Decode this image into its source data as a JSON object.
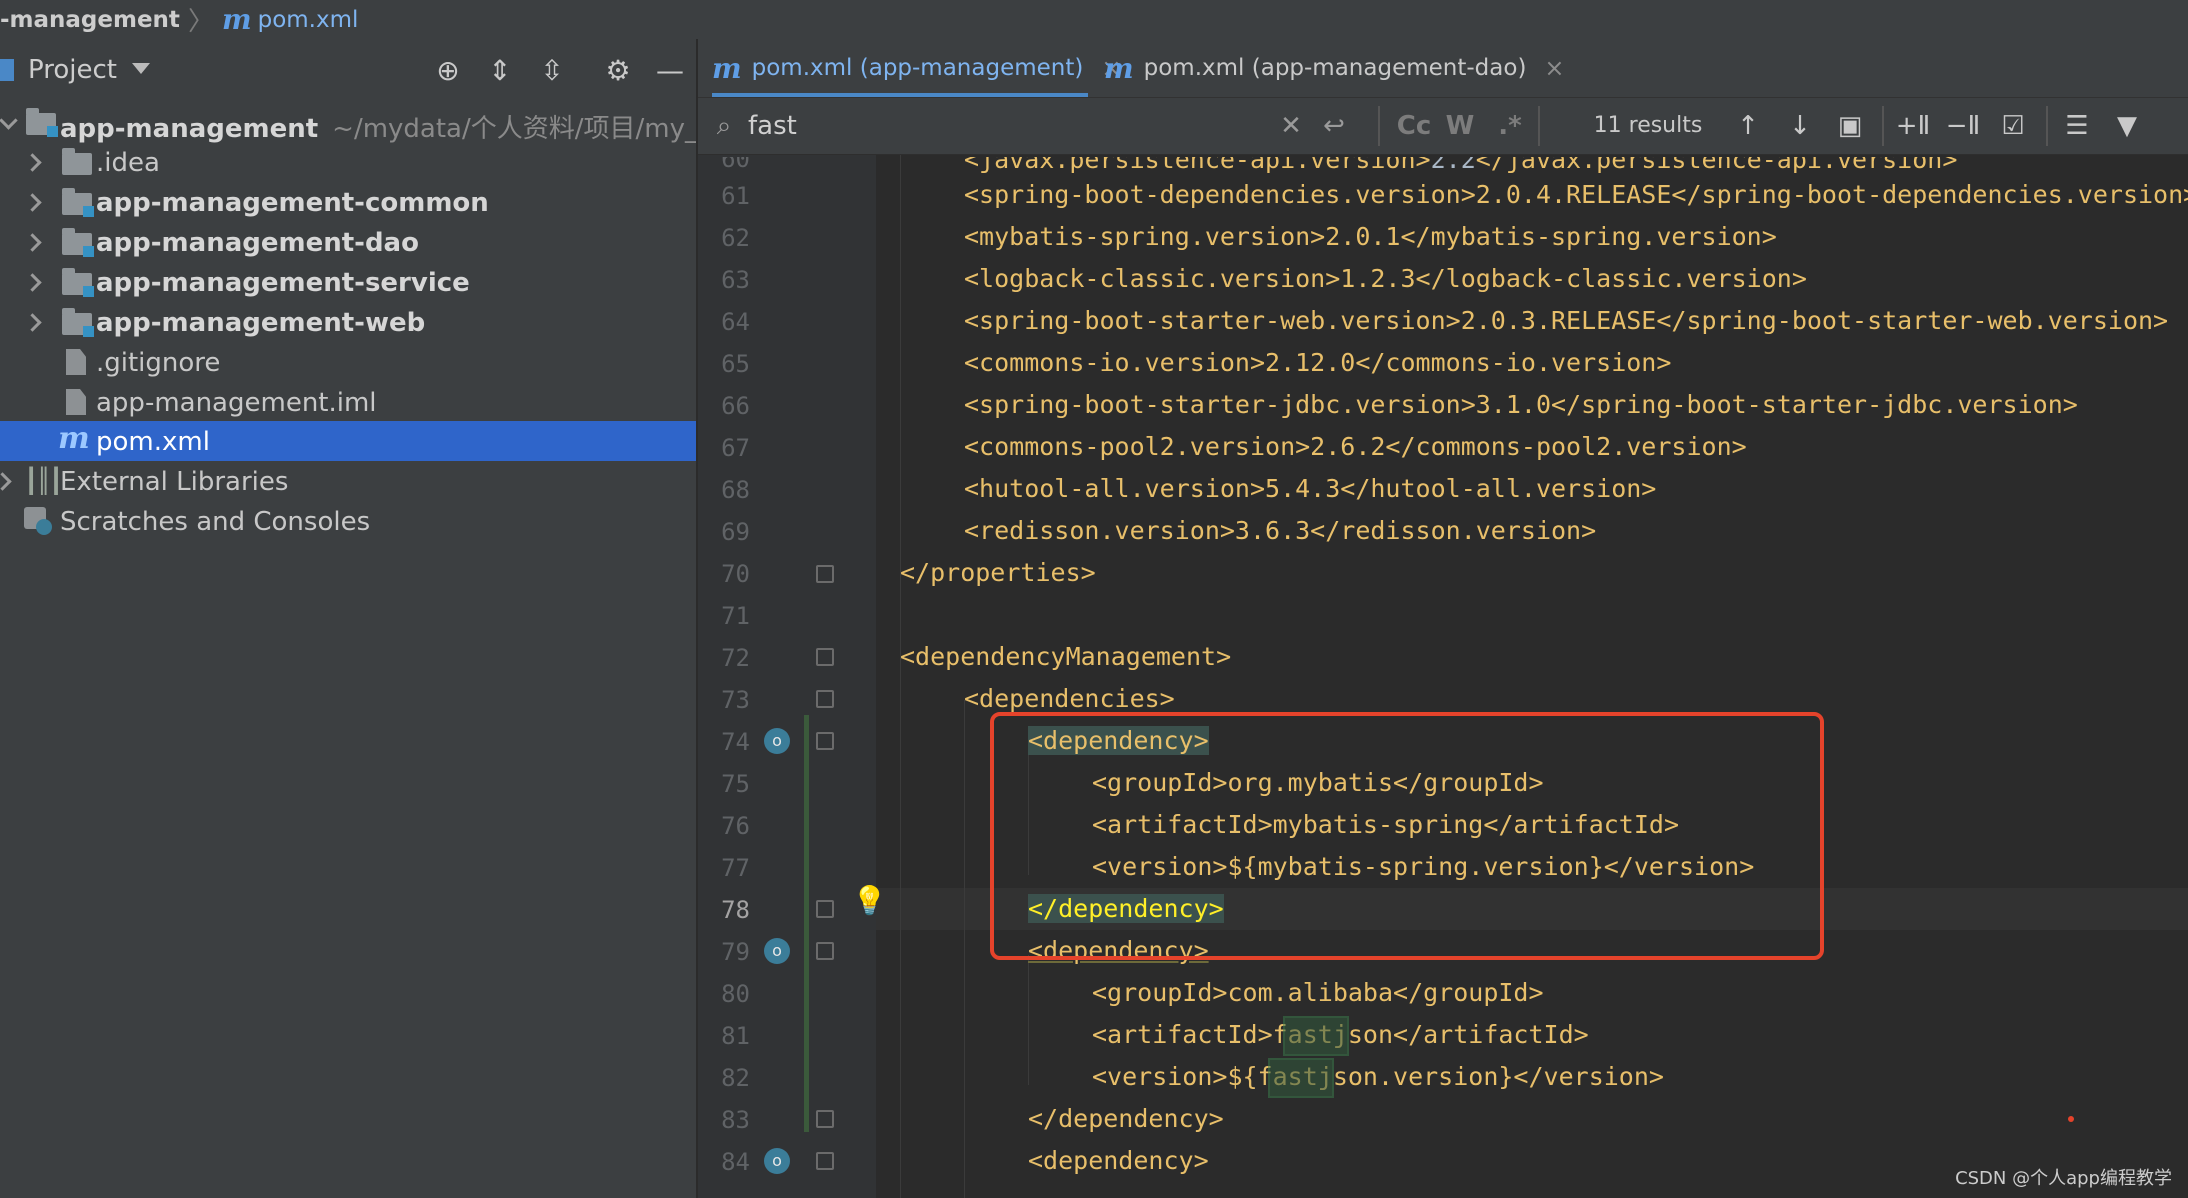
{
  "breadcrumb": {
    "project": "-management",
    "file_mark": "m",
    "file": "pom.xml"
  },
  "project_panel": {
    "title": "Project",
    "tree": [
      {
        "label": "app-management",
        "path": "~/mydata/个人资料/项目/my_pro",
        "bold": true
      },
      {
        "label": ".idea"
      },
      {
        "label": "app-management-common",
        "bold": true
      },
      {
        "label": "app-management-dao",
        "bold": true
      },
      {
        "label": "app-management-service",
        "bold": true
      },
      {
        "label": "app-management-web",
        "bold": true
      },
      {
        "label": ".gitignore"
      },
      {
        "label": "app-management.iml"
      },
      {
        "label": "pom.xml",
        "selected": true
      },
      {
        "label": "External Libraries"
      },
      {
        "label": "Scratches and Consoles"
      }
    ]
  },
  "tabs": [
    {
      "mark": "m",
      "label": "pom.xml (app-management)",
      "close": "×",
      "active": true
    },
    {
      "mark": "m",
      "label": "pom.xml (app-management-dao)",
      "close": "×",
      "active": false
    }
  ],
  "find": {
    "query": "fast",
    "case_label": "Cc",
    "word_label": "W",
    "regex_label": ".*",
    "results": "11 results"
  },
  "editor": {
    "current_line": "78",
    "lines": [
      {
        "n": "61",
        "text": "<spring-boot-dependencies.version>2.0.4.RELEASE</spring-boot-dependencies.version>"
      },
      {
        "n": "62",
        "text": "<mybatis-spring.version>2.0.1</mybatis-spring.version>"
      },
      {
        "n": "63",
        "text": "<logback-classic.version>1.2.3</logback-classic.version>"
      },
      {
        "n": "64",
        "text": "<spring-boot-starter-web.version>2.0.3.RELEASE</spring-boot-starter-web.version>"
      },
      {
        "n": "65",
        "text": "<commons-io.version>2.12.0</commons-io.version>"
      },
      {
        "n": "66",
        "text": "<spring-boot-starter-jdbc.version>3.1.0</spring-boot-starter-jdbc.version>"
      },
      {
        "n": "67",
        "text": "<commons-pool2.version>2.6.2</commons-pool2.version>"
      },
      {
        "n": "68",
        "text": "<hutool-all.version>5.4.3</hutool-all.version>"
      },
      {
        "n": "69",
        "text": "<redisson.version>3.6.3</redisson.version>"
      },
      {
        "n": "70",
        "text": "</properties>"
      },
      {
        "n": "71",
        "text": ""
      },
      {
        "n": "72",
        "text": "<dependencyManagement>"
      },
      {
        "n": "73",
        "text": "<dependencies>"
      },
      {
        "n": "74",
        "text": "<dependency>"
      },
      {
        "n": "75",
        "text": "<groupId>org.mybatis</groupId>"
      },
      {
        "n": "76",
        "text": "<artifactId>mybatis-spring</artifactId>"
      },
      {
        "n": "77",
        "text": "<version>${mybatis-spring.version}</version>"
      },
      {
        "n": "78",
        "text": "</dependency>"
      },
      {
        "n": "79",
        "text": "<dependency>"
      },
      {
        "n": "80",
        "text": "<groupId>com.alibaba</groupId>"
      },
      {
        "n": "81",
        "text": "<artifactId>fastjson</artifactId>"
      },
      {
        "n": "82",
        "text": "<version>${fastjson.version}</version>"
      },
      {
        "n": "83",
        "text": "</dependency>"
      },
      {
        "n": "84",
        "text": "<dependency>"
      }
    ]
  },
  "watermark": "CSDN @个人app编程教学",
  "colors": {
    "accent": "#2f65ca",
    "tag": "#e8bf6a",
    "annotation_box": "#e5432b",
    "search_match": "#32593d"
  }
}
